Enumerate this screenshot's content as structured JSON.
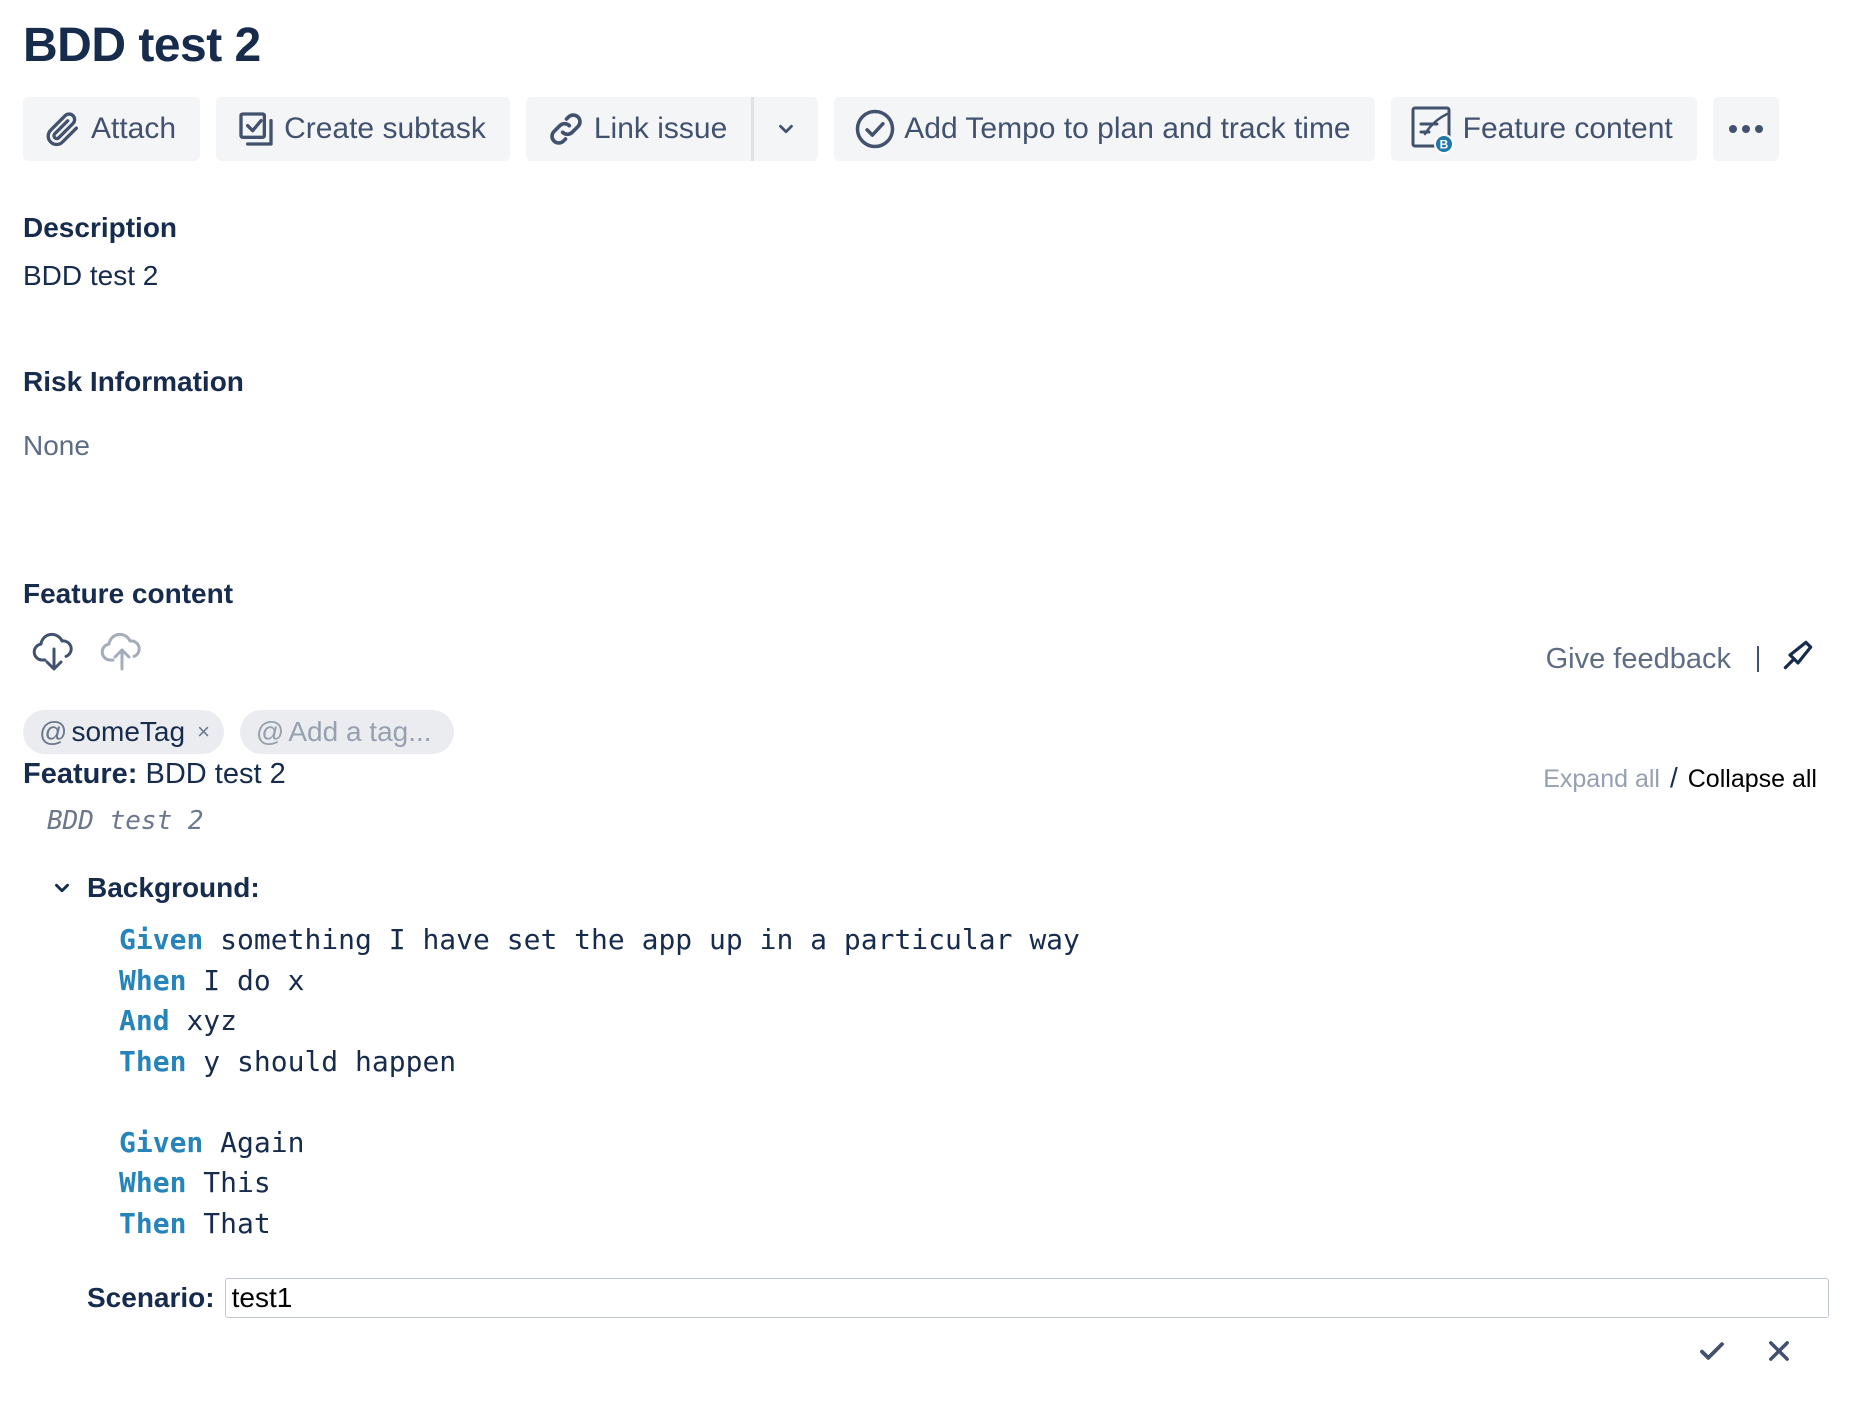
{
  "issue": {
    "title": "BDD test 2"
  },
  "toolbar": {
    "attach": "Attach",
    "create_subtask": "Create subtask",
    "link_issue": "Link issue",
    "tempo": "Add Tempo to plan and track time",
    "feature_content": "Feature content"
  },
  "description": {
    "heading": "Description",
    "value": "BDD test 2"
  },
  "risk": {
    "heading": "Risk Information",
    "value": "None"
  },
  "feature_content": {
    "heading": "Feature content",
    "give_feedback": "Give feedback",
    "tags": [
      {
        "prefix": "@",
        "name": "someTag",
        "remove": "×"
      }
    ],
    "add_tag": {
      "prefix": "@",
      "placeholder": "Add a tag..."
    },
    "expand_all": "Expand all",
    "separator": "/",
    "collapse_all": "Collapse all",
    "feature_label": "Feature:",
    "feature_name": "BDD test 2",
    "feature_description": "BDD test 2",
    "background_label": "Background:",
    "steps": [
      {
        "keyword": "Given",
        "text": "something I have set the app up in a particular way"
      },
      {
        "keyword": "When",
        "text": "I do x"
      },
      {
        "keyword": "And",
        "text": "xyz"
      },
      {
        "keyword": "Then",
        "text": "y should happen"
      },
      {
        "keyword": "Given",
        "text": "Again"
      },
      {
        "keyword": "When",
        "text": "This"
      },
      {
        "keyword": "Then",
        "text": "That"
      }
    ],
    "scenario_label": "Scenario:",
    "scenario_value": "test1"
  },
  "colors": {
    "text": "#172b4d",
    "muted": "#5e6c84",
    "keyword": "#2684ba",
    "button_bg": "#f4f5f7",
    "badge": "#1f78a8"
  },
  "icons": [
    "paperclip-icon",
    "subtask-icon",
    "link-icon",
    "chevron-down-icon",
    "check-circle-icon",
    "feature-doc-icon",
    "more-icon",
    "cloud-download-icon",
    "cloud-upload-icon",
    "megaphone-icon",
    "check-icon",
    "close-icon"
  ]
}
